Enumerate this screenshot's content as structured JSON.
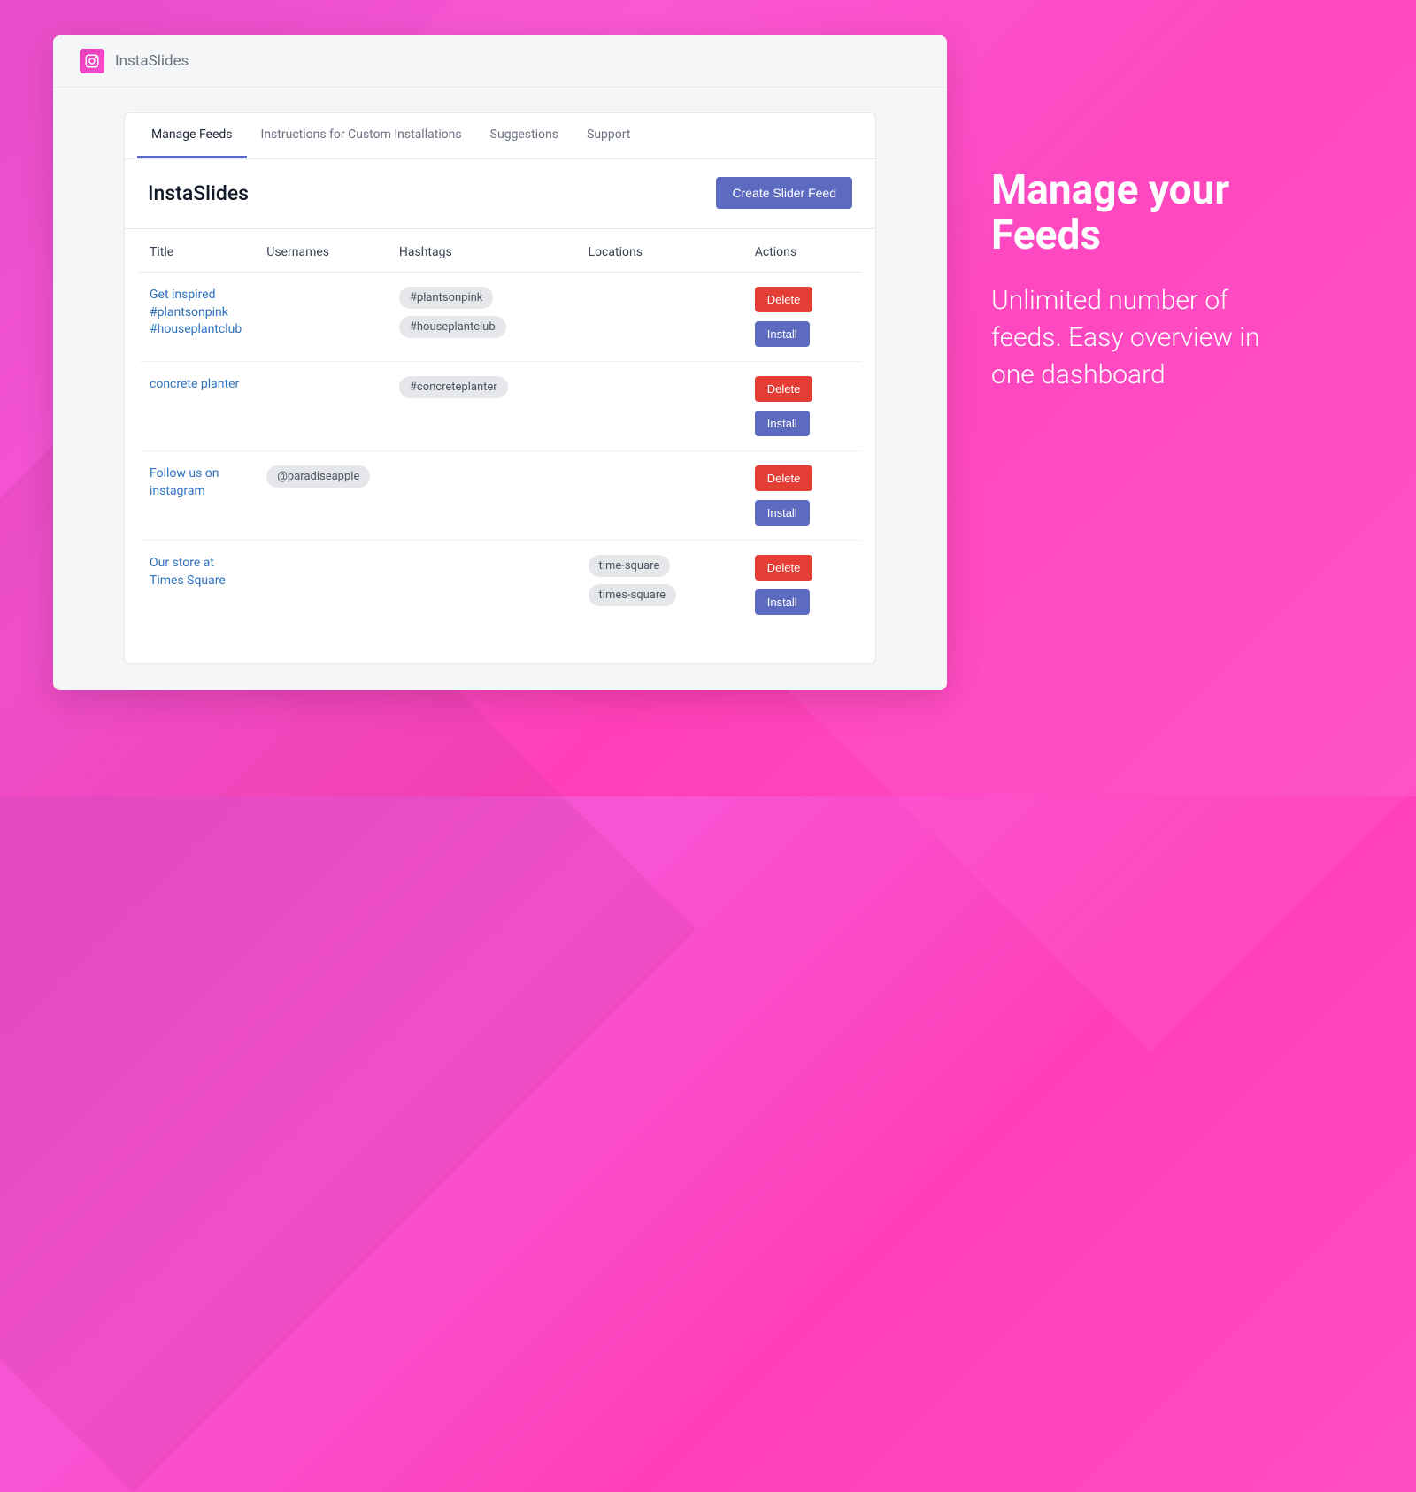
{
  "app": {
    "title": "InstaSlides"
  },
  "tabs": [
    {
      "label": "Manage Feeds",
      "active": true
    },
    {
      "label": "Instructions for Custom Installations",
      "active": false
    },
    {
      "label": "Suggestions",
      "active": false
    },
    {
      "label": "Support",
      "active": false
    }
  ],
  "content": {
    "heading": "InstaSlides",
    "create_button": "Create Slider Feed"
  },
  "table": {
    "columns": [
      "Title",
      "Usernames",
      "Hashtags",
      "Locations",
      "Actions"
    ],
    "rows": [
      {
        "title": "Get inspired #plantsonpink #houseplantclub",
        "usernames": [],
        "hashtags": [
          "#plantsonpink",
          "#houseplantclub"
        ],
        "locations": []
      },
      {
        "title": "concrete planter",
        "usernames": [],
        "hashtags": [
          "#concreteplanter"
        ],
        "locations": []
      },
      {
        "title": "Follow us on instagram",
        "usernames": [
          "@paradiseapple"
        ],
        "hashtags": [],
        "locations": []
      },
      {
        "title": "Our store at Times Square",
        "usernames": [],
        "hashtags": [],
        "locations": [
          "time-square",
          "times-square"
        ]
      }
    ],
    "actions": {
      "delete": "Delete",
      "install": "Install"
    }
  },
  "promo": {
    "title": "Manage your Feeds",
    "text": "Unlimited number of feeds. Easy overview in one dashboard"
  }
}
